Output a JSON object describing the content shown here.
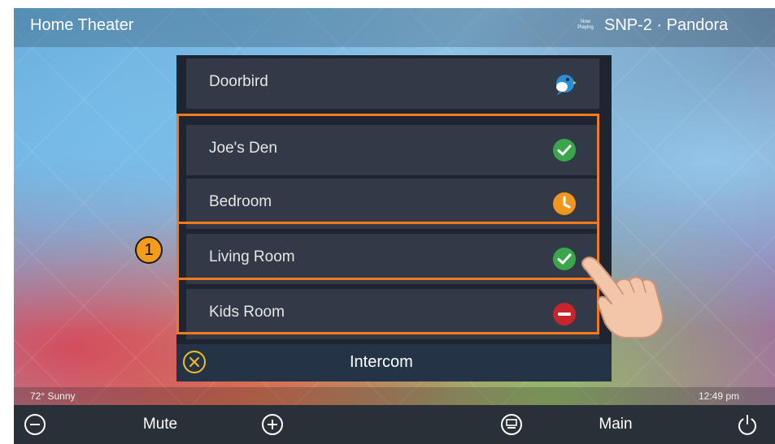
{
  "header": {
    "title": "Home Theater",
    "now_playing_badge": "Now Playing",
    "source": "SNP-2 · Pandora"
  },
  "intercom_panel": {
    "items": [
      {
        "label": "Doorbird",
        "status_icon": "bird-icon"
      },
      {
        "label": "Joe's Den",
        "status_icon": "check-circle-icon",
        "status_color": "#3aa64a"
      },
      {
        "label": "Bedroom",
        "status_icon": "clock-icon",
        "status_color": "#f0961e"
      },
      {
        "label": "Living Room",
        "status_icon": "check-circle-icon",
        "status_color": "#3aa64a"
      },
      {
        "label": "Kids Room",
        "status_icon": "minus-circle-icon",
        "status_color": "#c8242c"
      }
    ],
    "footer_label": "Intercom",
    "close_icon": "close-circle-icon"
  },
  "callout": {
    "number": "1"
  },
  "status_bar": {
    "weather": "72° Sunny",
    "time": "12:49 pm"
  },
  "bottom_bar": {
    "volume_down_icon": "minus-circle-icon",
    "mute_label": "Mute",
    "volume_up_icon": "plus-circle-icon",
    "dvr_icon": "media-icon",
    "main_label": "Main",
    "power_icon": "power-icon"
  },
  "colors": {
    "highlight": "#f27a1a",
    "panel": "#1e2530",
    "row": "#323a47",
    "footer": "#243446",
    "callout": "#f59c1a"
  }
}
